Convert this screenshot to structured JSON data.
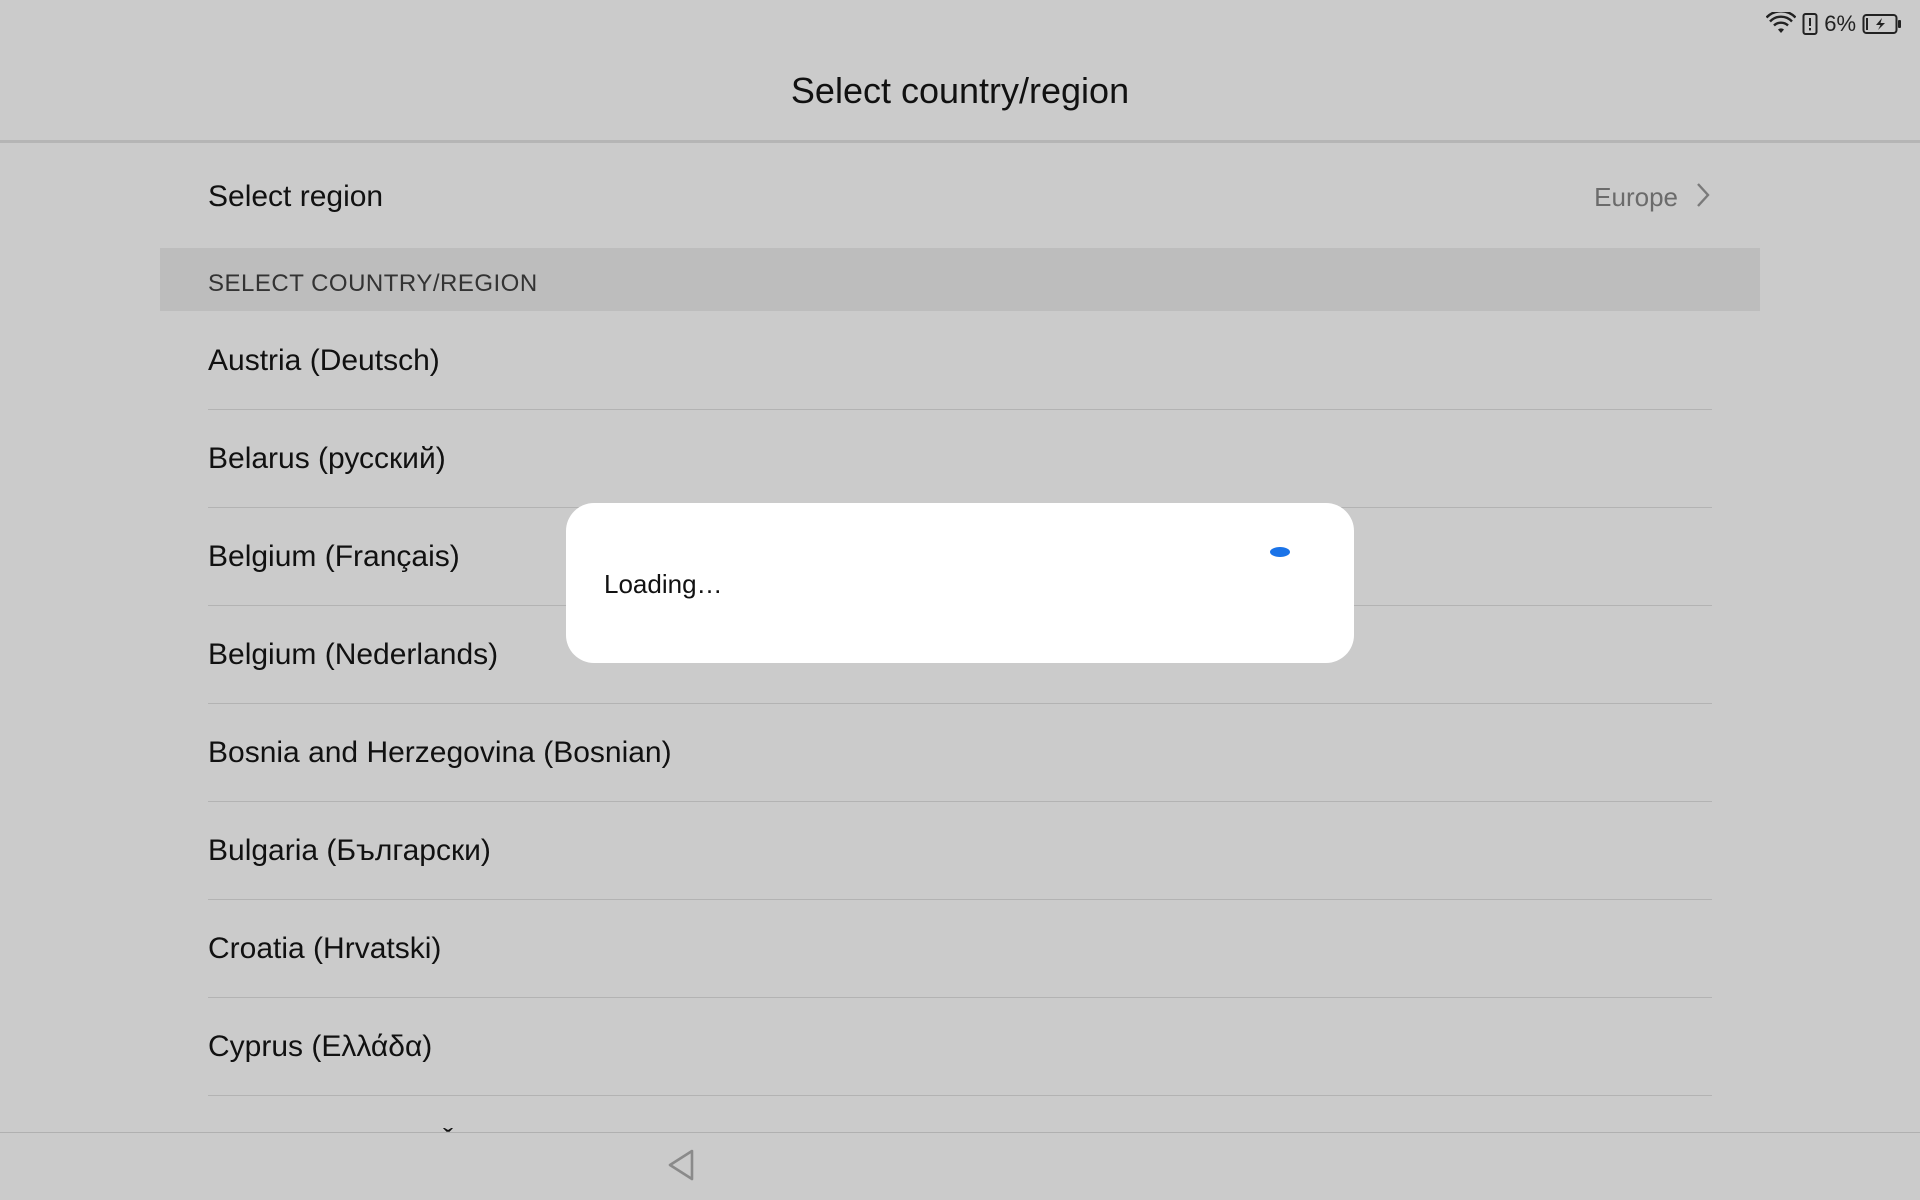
{
  "status_bar": {
    "battery_percent": "6%",
    "icons": [
      "wifi-icon",
      "alert-icon",
      "battery-charging-icon"
    ]
  },
  "header": {
    "title": "Select country/region"
  },
  "region": {
    "label": "Select region",
    "value": "Europe"
  },
  "section": {
    "header": "SELECT COUNTRY/REGION"
  },
  "countries": [
    "Austria (Deutsch)",
    "Belarus (русский)",
    "Belgium (Français)",
    "Belgium (Nederlands)",
    "Bosnia and Herzegovina (Bosnian)",
    "Bulgaria (Български)",
    "Croatia (Hrvatski)",
    "Cyprus (Ελλάδα)",
    "Czech Republic (Čeština)"
  ],
  "dialog": {
    "text": "Loading…"
  },
  "colors": {
    "background": "#cbcbcb",
    "dialog": "#ffffff",
    "spinner": "#1a73e8",
    "secondary_text": "#6b6b6b"
  }
}
